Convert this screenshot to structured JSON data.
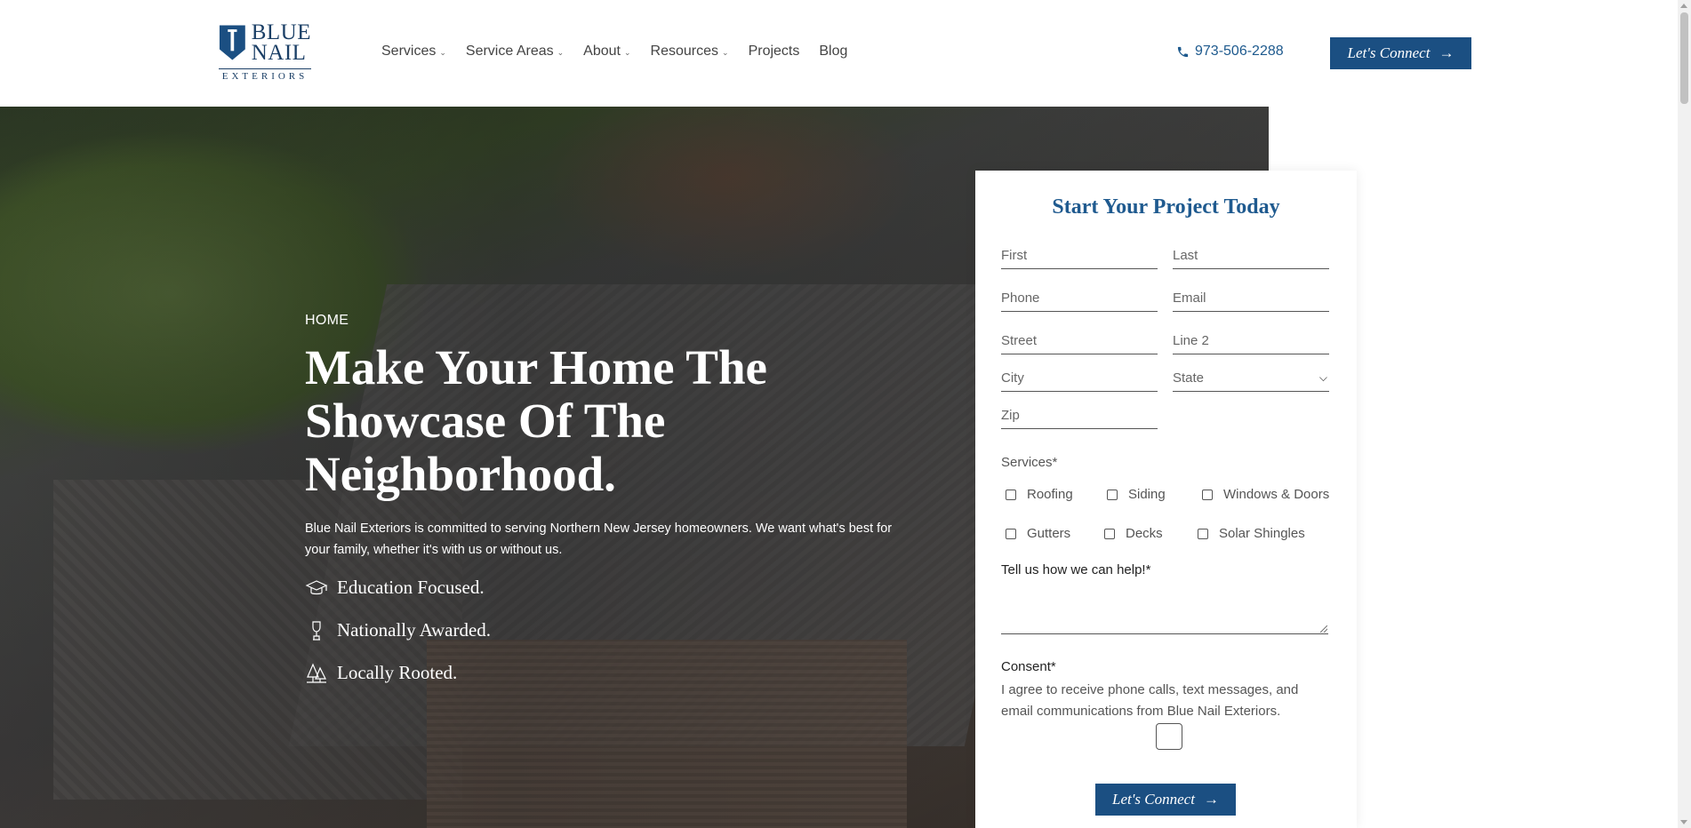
{
  "brand": {
    "logo_line1": "BLUE",
    "logo_line2": "NAIL",
    "logo_line3": "EXTERIORS",
    "color": "#1b4f82"
  },
  "nav": {
    "items": [
      {
        "label": "Services",
        "dropdown": true
      },
      {
        "label": "Service Areas",
        "dropdown": true
      },
      {
        "label": "About",
        "dropdown": true
      },
      {
        "label": "Resources",
        "dropdown": true
      },
      {
        "label": "Projects",
        "dropdown": false
      },
      {
        "label": "Blog",
        "dropdown": false
      }
    ],
    "phone": "973-506-2288",
    "cta_label": "Let's Connect"
  },
  "hero": {
    "breadcrumb": "HOME",
    "headline": "Make Your Home The Showcase Of The Neighborhood.",
    "intro": "Blue Nail Exteriors is committed to serving Northern New Jersey homeowners. We want what's best for your family, whether it's with us or without us.",
    "features": [
      {
        "icon": "graduation-cap-icon",
        "label": "Education Focused."
      },
      {
        "icon": "trophy-icon",
        "label": "Nationally Awarded."
      },
      {
        "icon": "trees-icon",
        "label": "Locally Rooted."
      }
    ]
  },
  "form": {
    "title": "Start Your Project Today",
    "placeholders": {
      "first": "First",
      "last": "Last",
      "phone": "Phone",
      "email": "Email",
      "street": "Street",
      "line2": "Line 2",
      "city": "City",
      "state": "State",
      "zip": "Zip"
    },
    "services_label": "Services*",
    "services": [
      "Roofing",
      "Siding",
      "Windows & Doors",
      "Gutters",
      "Decks",
      "Solar Shingles"
    ],
    "help_label": "Tell us how we can help!*",
    "consent_label": "Consent*",
    "consent_text": "I agree to receive phone calls, text messages, and email communications from Blue Nail Exteriors.",
    "submit_label": "Let's Connect"
  }
}
